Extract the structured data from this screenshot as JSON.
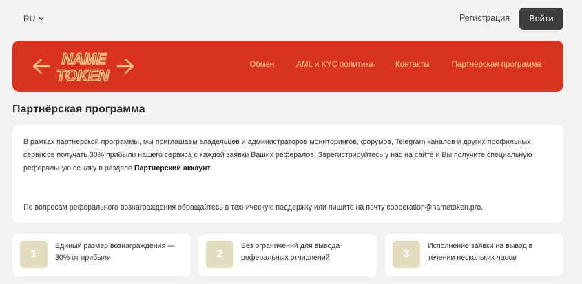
{
  "top_bar": {
    "language": "RU",
    "register_label": "Регистрация",
    "login_label": "Войти"
  },
  "header": {
    "logo_line1": "NAME",
    "logo_line2": "TOKEN",
    "nav": [
      "Обмен",
      "AML и KYC политика",
      "Контакты",
      "Партнёрская программа"
    ]
  },
  "page": {
    "title": "Партнёрская программа",
    "paragraph1_start": "В рамках партнерской программы, мы приглашаем владельцев и администраторов мониторингов, форумов, Telegram каналов и других профильных сервисов получать 30% прибыли нашего сервиса с каждой заявки Ваших рефералов. Зарегистрируйтесь у нас на сайте и Вы получите специальную реферальную ссылку в разделе ",
    "paragraph1_bold": "Партнерский аккаунт",
    "paragraph1_end": ".",
    "paragraph2": "По вопросам реферального вознаграждения обращайтесь в техническую поддержку или пишите на почту cooperation@nametoken.pro."
  },
  "features": [
    {
      "number": "1",
      "text": "Единый размер вознаграждения — 30% от прибыли"
    },
    {
      "number": "2",
      "text": "Без ограничений для вывода реферальных отчислений"
    },
    {
      "number": "3",
      "text": "Исполнение заявки на вывод в течении нескольких часов"
    }
  ],
  "colors": {
    "header_red": "#d9321f",
    "nav_link": "#f6d39b",
    "logo": "#f4d08c",
    "login_button": "#3d3d3d",
    "number_badge": "#e3dcbf"
  }
}
